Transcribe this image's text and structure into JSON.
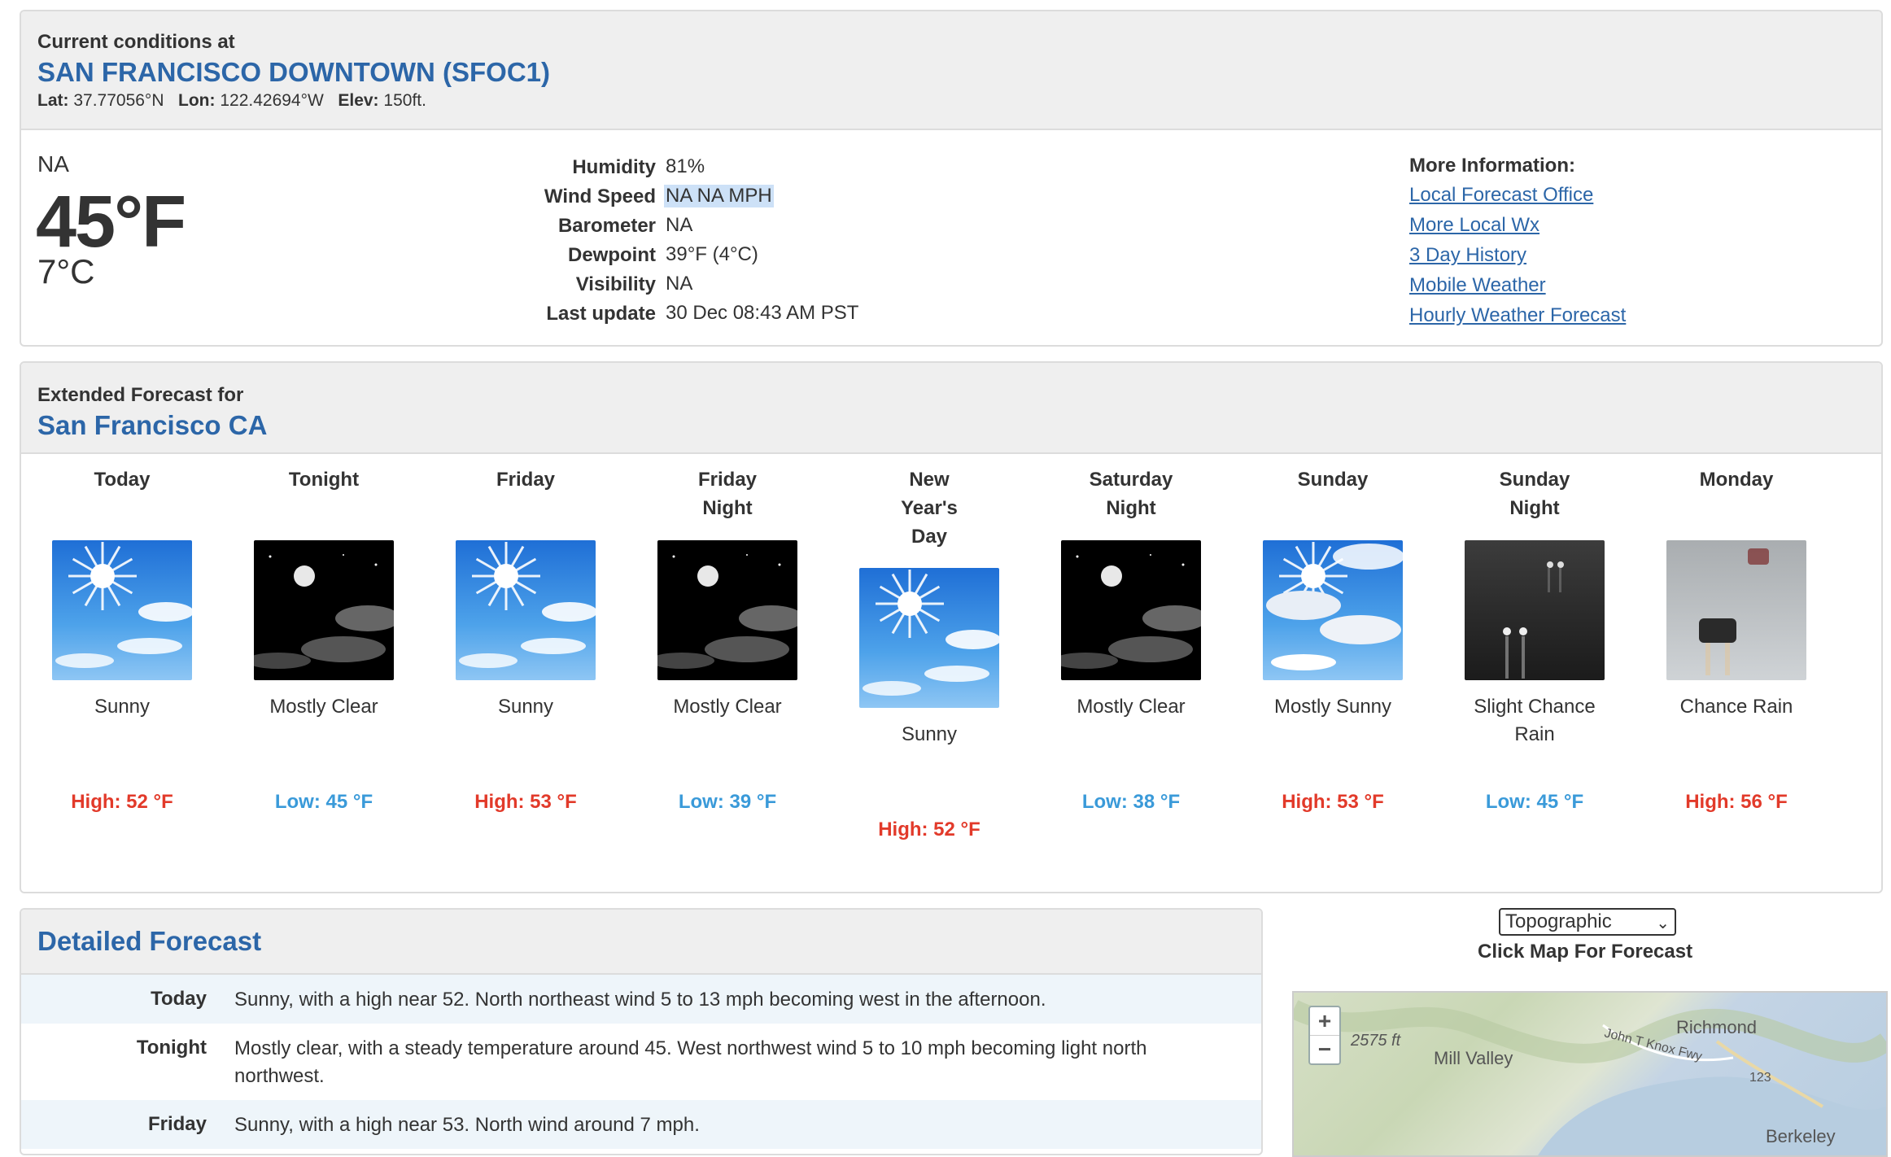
{
  "current": {
    "label": "Current conditions at",
    "station": "SAN FRANCISCO DOWNTOWN (SFOC1)",
    "lat_label": "Lat:",
    "lat": "37.77056°N",
    "lon_label": "Lon:",
    "lon": "122.42694°W",
    "elev_label": "Elev:",
    "elev": "150ft.",
    "condition": "NA",
    "temp_f": "45°F",
    "temp_c": "7°C",
    "details": [
      {
        "key": "Humidity",
        "value": "81%"
      },
      {
        "key": "Wind Speed",
        "value": "NA NA MPH"
      },
      {
        "key": "Barometer",
        "value": "NA"
      },
      {
        "key": "Dewpoint",
        "value": "39°F (4°C)"
      },
      {
        "key": "Visibility",
        "value": "NA"
      },
      {
        "key": "Last update",
        "value": "30 Dec 08:43 AM PST"
      }
    ],
    "more_title": "More Information:",
    "links": [
      "Local Forecast Office",
      "More Local Wx",
      "3 Day History",
      "Mobile Weather",
      "Hourly Weather Forecast"
    ]
  },
  "extended": {
    "label": "Extended Forecast for",
    "place": "San Francisco CA",
    "periods": [
      {
        "name": "Today",
        "icon": "sunny-icon",
        "desc": "Sunny",
        "temp": "High: 52 °F",
        "kind": "high"
      },
      {
        "name": "Tonight",
        "icon": "mostly-clear-night-icon",
        "desc": "Mostly Clear",
        "temp": "Low: 45 °F",
        "kind": "low"
      },
      {
        "name": "Friday",
        "icon": "sunny-icon",
        "desc": "Sunny",
        "temp": "High: 53 °F",
        "kind": "high"
      },
      {
        "name": "Friday Night",
        "icon": "mostly-clear-night-icon",
        "desc": "Mostly Clear",
        "temp": "Low: 39 °F",
        "kind": "low"
      },
      {
        "name": "New Year's Day",
        "icon": "sunny-icon",
        "desc": "Sunny",
        "temp": "High: 52 °F",
        "kind": "high"
      },
      {
        "name": "Saturday Night",
        "icon": "mostly-clear-night-icon",
        "desc": "Mostly Clear",
        "temp": "Low: 38 °F",
        "kind": "low"
      },
      {
        "name": "Sunday",
        "icon": "mostly-sunny-icon",
        "desc": "Mostly Sunny",
        "temp": "High: 53 °F",
        "kind": "high"
      },
      {
        "name": "Sunday Night",
        "icon": "rain-night-icon",
        "desc": "Slight Chance Rain",
        "temp": "Low: 45 °F",
        "kind": "low"
      },
      {
        "name": "Monday",
        "icon": "rain-day-icon",
        "desc": "Chance Rain",
        "temp": "High: 56 °F",
        "kind": "high"
      }
    ]
  },
  "detailed": {
    "title": "Detailed Forecast",
    "rows": [
      {
        "key": "Today",
        "value": "Sunny, with a high near 52. North northeast wind 5 to 13 mph becoming west in the afternoon."
      },
      {
        "key": "Tonight",
        "value": "Mostly clear, with a steady temperature around 45. West northwest wind 5 to 10 mph becoming light north northwest."
      },
      {
        "key": "Friday",
        "value": "Sunny, with a high near 53. North wind around 7 mph."
      }
    ]
  },
  "map": {
    "select_value": "Topographic",
    "caption": "Click Map For Forecast",
    "zoom_in": "+",
    "zoom_out": "−",
    "labels": [
      "2575 ft",
      "Mill Valley",
      "Richmond",
      "John T Knox Fwy",
      "123",
      "Berkeley"
    ]
  },
  "colors": {
    "link": "#2c66a8",
    "high": "#e23a2a",
    "low": "#3a9ad9",
    "highlight": "#cde1f7"
  }
}
